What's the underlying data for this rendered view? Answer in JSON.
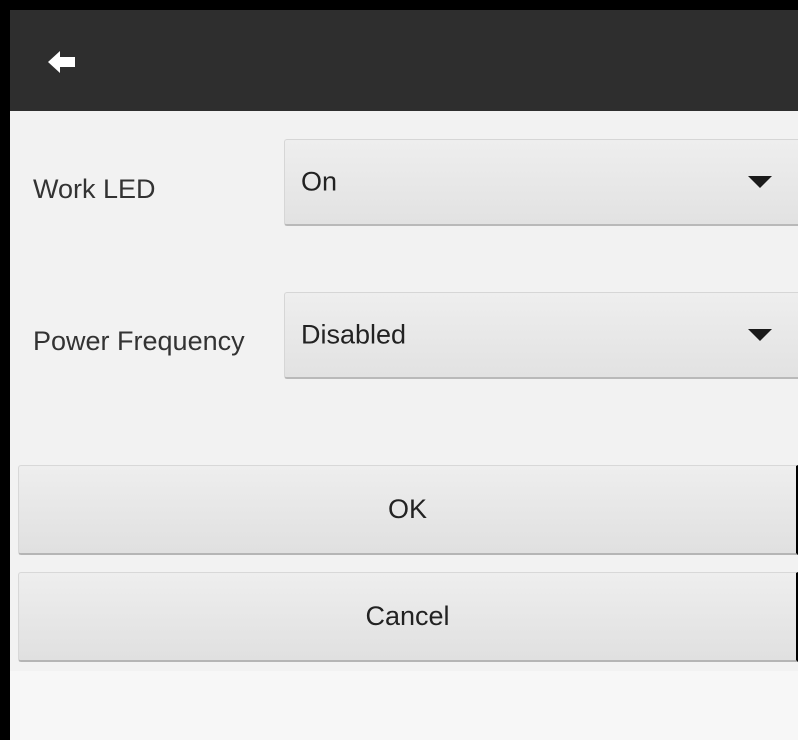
{
  "toolbar": {
    "back_icon": "back-arrow-icon",
    "background_color": "#2e2e2e"
  },
  "settings": {
    "work_led": {
      "label": "Work LED",
      "value": "On"
    },
    "power_frequency": {
      "label": "Power Frequency",
      "value": "Disabled"
    }
  },
  "actions": {
    "ok_label": "OK",
    "cancel_label": "Cancel"
  }
}
